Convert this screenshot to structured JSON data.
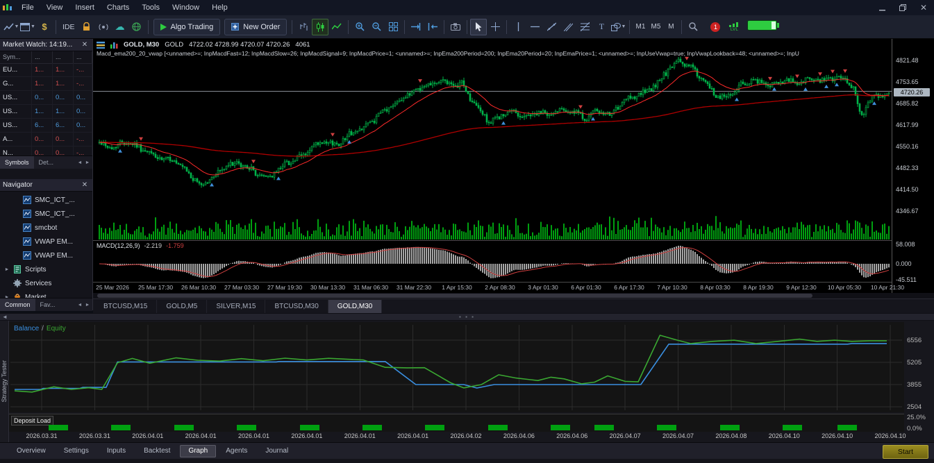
{
  "titlebar": {
    "menu": [
      "File",
      "View",
      "Insert",
      "Charts",
      "Tools",
      "Window",
      "Help"
    ]
  },
  "toolbar": {
    "ide_label": "IDE",
    "algo_trading_label": "Algo Trading",
    "new_order_label": "New Order",
    "timeframes": [
      "M1",
      "M5",
      "M"
    ],
    "notification_count": "1",
    "lvl_label": "LVL"
  },
  "market_watch": {
    "title": "Market Watch: 14:19...",
    "columns": [
      "Sym...",
      "...",
      "...",
      "..."
    ],
    "rows": [
      {
        "symbol": "EU...",
        "bid": "1...",
        "ask": "1...",
        "chg": "-...",
        "color": "#d05050"
      },
      {
        "symbol": "G...",
        "bid": "1...",
        "ask": "1...",
        "chg": "-...",
        "color": "#d05050"
      },
      {
        "symbol": "US...",
        "bid": "0...",
        "ask": "0...",
        "chg": "0...",
        "color": "#4f9bdc"
      },
      {
        "symbol": "US...",
        "bid": "1...",
        "ask": "1...",
        "chg": "0...",
        "color": "#4f9bdc"
      },
      {
        "symbol": "US...",
        "bid": "6...",
        "ask": "6...",
        "chg": "0...",
        "color": "#4f9bdc"
      },
      {
        "symbol": "A...",
        "bid": "0...",
        "ask": "0...",
        "chg": "-...",
        "color": "#d05050"
      },
      {
        "symbol": "N...",
        "bid": "0...",
        "ask": "0...",
        "chg": "-...",
        "color": "#d05050"
      }
    ],
    "tabs": [
      "Symbols",
      "Det..."
    ]
  },
  "navigator": {
    "title": "Navigator",
    "items": [
      {
        "label": "SMC_ICT_...",
        "icon": "ea-icon",
        "indent": 1,
        "expander": false
      },
      {
        "label": "SMC_ICT_...",
        "icon": "ea-icon",
        "indent": 1,
        "expander": false
      },
      {
        "label": "smcbot",
        "icon": "ea-icon",
        "indent": 1,
        "expander": false
      },
      {
        "label": "VWAP EM...",
        "icon": "ea-icon",
        "indent": 1,
        "expander": false
      },
      {
        "label": "VWAP EM...",
        "icon": "ea-icon",
        "indent": 1,
        "expander": false
      },
      {
        "label": "Scripts",
        "icon": "scripts-icon",
        "indent": 0,
        "expander": true
      },
      {
        "label": "Services",
        "icon": "services-icon",
        "indent": 0,
        "expander": false
      },
      {
        "label": "Market",
        "icon": "market-icon",
        "indent": 0,
        "expander": true
      }
    ],
    "tabs": [
      "Common",
      "Fav..."
    ]
  },
  "chart": {
    "symbol_period": "GOLD, M30",
    "symbol_name": "GOLD",
    "ohlc": "4722.02 4728.99 4720.07 4720.26",
    "volume": "4061",
    "indicator_line": "Macd_ema200_20_vwap [<unnamed>=; InpMacdFast=12; InpMacdSlow=26; InpMacdSignal=9; InpMacdPrice=1; <unnamed>=; InpEma200Period=200; InpEma20Period=20; InpEmaPrice=1; <unnamed>=; InpUseVwap=true; InpVwapLookback=48; <unnamed>=; InpU",
    "current_price": "4720.26",
    "price_labels": [
      "4821.48",
      "4753.65",
      "4685.82",
      "4617.99",
      "4550.16",
      "4482.33",
      "4414.50",
      "4346.67"
    ],
    "macd_title": "MACD(12,26,9)",
    "macd_value1": "-2.219",
    "macd_value2": "-1.759",
    "macd_scale": [
      "58.008",
      "0.000",
      "-45.511"
    ],
    "time_labels": [
      "25 Mar 2026",
      "25 Mar 17:30",
      "26 Mar 10:30",
      "27 Mar 03:30",
      "27 Mar 19:30",
      "30 Mar 13:30",
      "31 Mar 06:30",
      "31 Mar 22:30",
      "1 Apr 15:30",
      "2 Apr 08:30",
      "3 Apr 01:30",
      "6 Apr 01:30",
      "6 Apr 17:30",
      "7 Apr 10:30",
      "8 Apr 03:30",
      "8 Apr 19:30",
      "9 Apr 12:30",
      "10 Apr 05:30",
      "10 Apr 21:30"
    ]
  },
  "chart_tabs": [
    {
      "label": "BTCUSD,M15",
      "active": false
    },
    {
      "label": "GOLD,M5",
      "active": false
    },
    {
      "label": "SILVER,M15",
      "active": false
    },
    {
      "label": "BTCUSD,M30",
      "active": false
    },
    {
      "label": "GOLD,M30",
      "active": true
    }
  ],
  "tester": {
    "side_label": "Strategy Tester",
    "legend": {
      "balance": "Balance",
      "separator": "/",
      "equity": "Equity"
    },
    "deposit_label": "Deposit Load",
    "y_labels": [
      "6556",
      "5205",
      "3855",
      "2504"
    ],
    "percent_labels": [
      "25.0%",
      "0.0%"
    ],
    "x_labels": [
      "2026.03.31",
      "2026.03.31",
      "2026.04.01",
      "2026.04.01",
      "2026.04.01",
      "2026.04.01",
      "2026.04.01",
      "2026.04.01",
      "2026.04.02",
      "2026.04.06",
      "2026.04.06",
      "2026.04.07",
      "2026.04.07",
      "2026.04.08",
      "2026.04.10",
      "2026.04.10",
      "2026.04.10"
    ],
    "tabs": [
      {
        "label": "Overview",
        "active": false
      },
      {
        "label": "Settings",
        "active": false
      },
      {
        "label": "Inputs",
        "active": false
      },
      {
        "label": "Backtest",
        "active": false
      },
      {
        "label": "Graph",
        "active": true
      },
      {
        "label": "Agents",
        "active": false
      },
      {
        "label": "Journal",
        "active": false
      }
    ],
    "start_label": "Start"
  },
  "colors": {
    "balance_line": "#3a8fe0",
    "equity_line": "#3aa832",
    "candle": "#00b44a",
    "ema_fast": "#ff2a2a",
    "ema_slow": "#b00000",
    "volume": "#00a010",
    "deposit_bar": "#00a010",
    "macd_hist": "#cfcfcf",
    "macd_signal": "#d04040",
    "marker_up": "#3f8fd9",
    "marker_down": "#d04040"
  },
  "chart_data": [
    {
      "type": "candlestick",
      "symbol": "GOLD",
      "timeframe": "M30",
      "visible_range": {
        "high": 4821.48,
        "low": 4346.67,
        "last": 4720.26
      },
      "candle_count": 380,
      "indicators": [
        "EMA200",
        "EMA20",
        "VWAP",
        "MACD(12,26,9)"
      ],
      "price_path_anchors": [
        [
          0,
          4562
        ],
        [
          0.015,
          4545
        ],
        [
          0.035,
          4568
        ],
        [
          0.055,
          4540
        ],
        [
          0.075,
          4512
        ],
        [
          0.095,
          4505
        ],
        [
          0.11,
          4470
        ],
        [
          0.13,
          4425
        ],
        [
          0.145,
          4458
        ],
        [
          0.165,
          4495
        ],
        [
          0.185,
          4490
        ],
        [
          0.2,
          4462
        ],
        [
          0.215,
          4452
        ],
        [
          0.235,
          4496
        ],
        [
          0.255,
          4515
        ],
        [
          0.27,
          4548
        ],
        [
          0.285,
          4562
        ],
        [
          0.3,
          4555
        ],
        [
          0.315,
          4585
        ],
        [
          0.33,
          4605
        ],
        [
          0.345,
          4628
        ],
        [
          0.36,
          4660
        ],
        [
          0.375,
          4688
        ],
        [
          0.39,
          4712
        ],
        [
          0.405,
          4735
        ],
        [
          0.42,
          4748
        ],
        [
          0.435,
          4760
        ],
        [
          0.45,
          4735
        ],
        [
          0.458,
          4755
        ],
        [
          0.47,
          4700
        ],
        [
          0.48,
          4668
        ],
        [
          0.495,
          4625
        ],
        [
          0.51,
          4648
        ],
        [
          0.525,
          4660
        ],
        [
          0.54,
          4642
        ],
        [
          0.555,
          4658
        ],
        [
          0.57,
          4648
        ],
        [
          0.585,
          4672
        ],
        [
          0.6,
          4658
        ],
        [
          0.615,
          4640
        ],
        [
          0.63,
          4660
        ],
        [
          0.645,
          4648
        ],
        [
          0.66,
          4680
        ],
        [
          0.675,
          4710
        ],
        [
          0.69,
          4718
        ],
        [
          0.705,
          4745
        ],
        [
          0.72,
          4790
        ],
        [
          0.735,
          4820
        ],
        [
          0.75,
          4800
        ],
        [
          0.765,
          4755
        ],
        [
          0.78,
          4712
        ],
        [
          0.795,
          4705
        ],
        [
          0.81,
          4740
        ],
        [
          0.825,
          4758
        ],
        [
          0.84,
          4748
        ],
        [
          0.855,
          4742
        ],
        [
          0.87,
          4756
        ],
        [
          0.885,
          4750
        ],
        [
          0.9,
          4762
        ],
        [
          0.915,
          4756
        ],
        [
          0.93,
          4768
        ],
        [
          0.945,
          4758
        ],
        [
          0.955,
          4735
        ],
        [
          0.965,
          4645
        ],
        [
          0.975,
          4692
        ],
        [
          0.988,
          4714
        ],
        [
          1,
          4720
        ]
      ]
    },
    {
      "type": "line",
      "title": "Strategy Tester Balance / Equity",
      "y_ticks": [
        6556,
        5205,
        3855,
        2504
      ],
      "series": [
        {
          "name": "Balance",
          "color": "#3a8fe0",
          "points": [
            [
              0,
              3560
            ],
            [
              0.03,
              3560
            ],
            [
              0.033,
              3620
            ],
            [
              0.075,
              3620
            ],
            [
              0.078,
              3680
            ],
            [
              0.105,
              3680
            ],
            [
              0.118,
              5230
            ],
            [
              0.3,
              5230
            ],
            [
              0.303,
              5255
            ],
            [
              0.425,
              5255
            ],
            [
              0.46,
              3855
            ],
            [
              0.515,
              3855
            ],
            [
              0.53,
              3645
            ],
            [
              0.55,
              3855
            ],
            [
              0.718,
              3855
            ],
            [
              0.75,
              6310
            ],
            [
              0.955,
              6310
            ],
            [
              0.96,
              6350
            ],
            [
              1,
              6350
            ]
          ]
        },
        {
          "name": "Equity",
          "color": "#3aa832",
          "points": [
            [
              0,
              3470
            ],
            [
              0.02,
              3400
            ],
            [
              0.045,
              3720
            ],
            [
              0.065,
              3560
            ],
            [
              0.085,
              3660
            ],
            [
              0.1,
              3560
            ],
            [
              0.118,
              5180
            ],
            [
              0.135,
              5440
            ],
            [
              0.155,
              5150
            ],
            [
              0.185,
              5480
            ],
            [
              0.21,
              5330
            ],
            [
              0.235,
              5280
            ],
            [
              0.26,
              5430
            ],
            [
              0.285,
              5300
            ],
            [
              0.31,
              5460
            ],
            [
              0.335,
              5350
            ],
            [
              0.36,
              5450
            ],
            [
              0.4,
              5350
            ],
            [
              0.425,
              4900
            ],
            [
              0.45,
              4870
            ],
            [
              0.47,
              4880
            ],
            [
              0.5,
              3960
            ],
            [
              0.515,
              3650
            ],
            [
              0.535,
              3850
            ],
            [
              0.555,
              4450
            ],
            [
              0.575,
              4250
            ],
            [
              0.6,
              4100
            ],
            [
              0.615,
              4300
            ],
            [
              0.63,
              4200
            ],
            [
              0.65,
              3900
            ],
            [
              0.665,
              4000
            ],
            [
              0.68,
              4380
            ],
            [
              0.7,
              4050
            ],
            [
              0.715,
              4020
            ],
            [
              0.74,
              6850
            ],
            [
              0.76,
              6550
            ],
            [
              0.775,
              6350
            ],
            [
              0.8,
              6480
            ],
            [
              0.825,
              6550
            ],
            [
              0.85,
              6350
            ],
            [
              0.875,
              6480
            ],
            [
              0.9,
              6620
            ],
            [
              0.92,
              6480
            ],
            [
              0.94,
              6550
            ],
            [
              0.96,
              6480
            ],
            [
              0.98,
              6520
            ],
            [
              1,
              6520
            ]
          ]
        }
      ],
      "deposit_bars": {
        "percent_max": "25.0%",
        "percent_min": "0.0%",
        "positions": [
          0.05,
          0.122,
          0.194,
          0.266,
          0.338,
          0.41,
          0.482,
          0.554,
          0.626,
          0.676,
          0.748,
          0.82,
          0.892,
          0.955
        ]
      }
    }
  ]
}
